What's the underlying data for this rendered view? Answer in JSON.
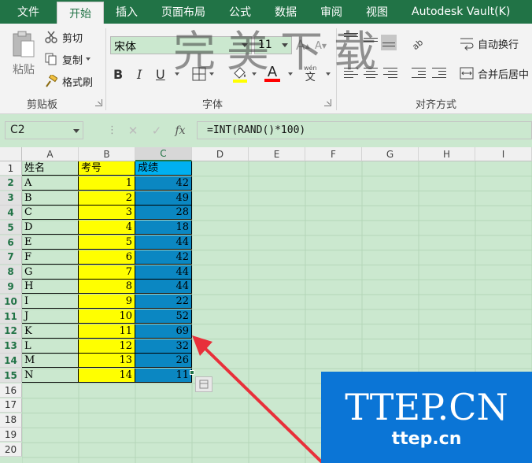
{
  "tabs": {
    "file": "文件",
    "home": "开始",
    "insert": "插入",
    "page_layout": "页面布局",
    "formulas": "公式",
    "data": "数据",
    "review": "审阅",
    "view": "视图",
    "vault": "Autodesk Vault(K)"
  },
  "clipboard": {
    "paste": "粘贴",
    "cut": "剪切",
    "copy": "复制",
    "format_painter": "格式刷",
    "group_label": "剪贴板"
  },
  "font": {
    "name": "宋体",
    "size": "11",
    "group_label": "字体",
    "bold": "B",
    "italic": "I",
    "underline": "U",
    "font_color_glyph": "A",
    "phonetic_glyph": "文",
    "phonetic_top": "wén",
    "highlight_color": "#ffff00",
    "font_color": "#ff0000"
  },
  "alignment": {
    "wrap_text": "自动换行",
    "merge_center": "合并后居中",
    "group_label": "对齐方式"
  },
  "formula_bar": {
    "name_box": "C2",
    "fx": "fx",
    "formula": "=INT(RAND()*100)"
  },
  "columns": [
    "A",
    "B",
    "C",
    "D",
    "E",
    "F",
    "G",
    "H",
    "I"
  ],
  "rows": [
    "1",
    "2",
    "3",
    "4",
    "5",
    "6",
    "7",
    "8",
    "9",
    "10",
    "11",
    "12",
    "13",
    "14",
    "15",
    "16",
    "17",
    "18",
    "19",
    "20"
  ],
  "table": {
    "headers": [
      "姓名",
      "考号",
      "成绩"
    ],
    "data": [
      [
        "A",
        "1",
        "42"
      ],
      [
        "B",
        "2",
        "49"
      ],
      [
        "C",
        "3",
        "28"
      ],
      [
        "D",
        "4",
        "18"
      ],
      [
        "E",
        "5",
        "44"
      ],
      [
        "F",
        "6",
        "42"
      ],
      [
        "G",
        "7",
        "44"
      ],
      [
        "H",
        "8",
        "44"
      ],
      [
        "I",
        "9",
        "22"
      ],
      [
        "J",
        "10",
        "52"
      ],
      [
        "K",
        "11",
        "69"
      ],
      [
        "L",
        "12",
        "32"
      ],
      [
        "M",
        "13",
        "26"
      ],
      [
        "N",
        "14",
        "11"
      ]
    ]
  },
  "watermark": {
    "big": "TTEP.CN",
    "small": "ttep.cn",
    "top": "完美下载"
  },
  "colors": {
    "excel_green": "#217346",
    "sheet_bg": "#cbe8cf",
    "yellow_fill": "#ffff00",
    "blue_fill": "#0b87c2",
    "header_blue": "#00b0f0",
    "watermark_blue": "#0b75d6",
    "arrow_red": "#e8303a"
  }
}
